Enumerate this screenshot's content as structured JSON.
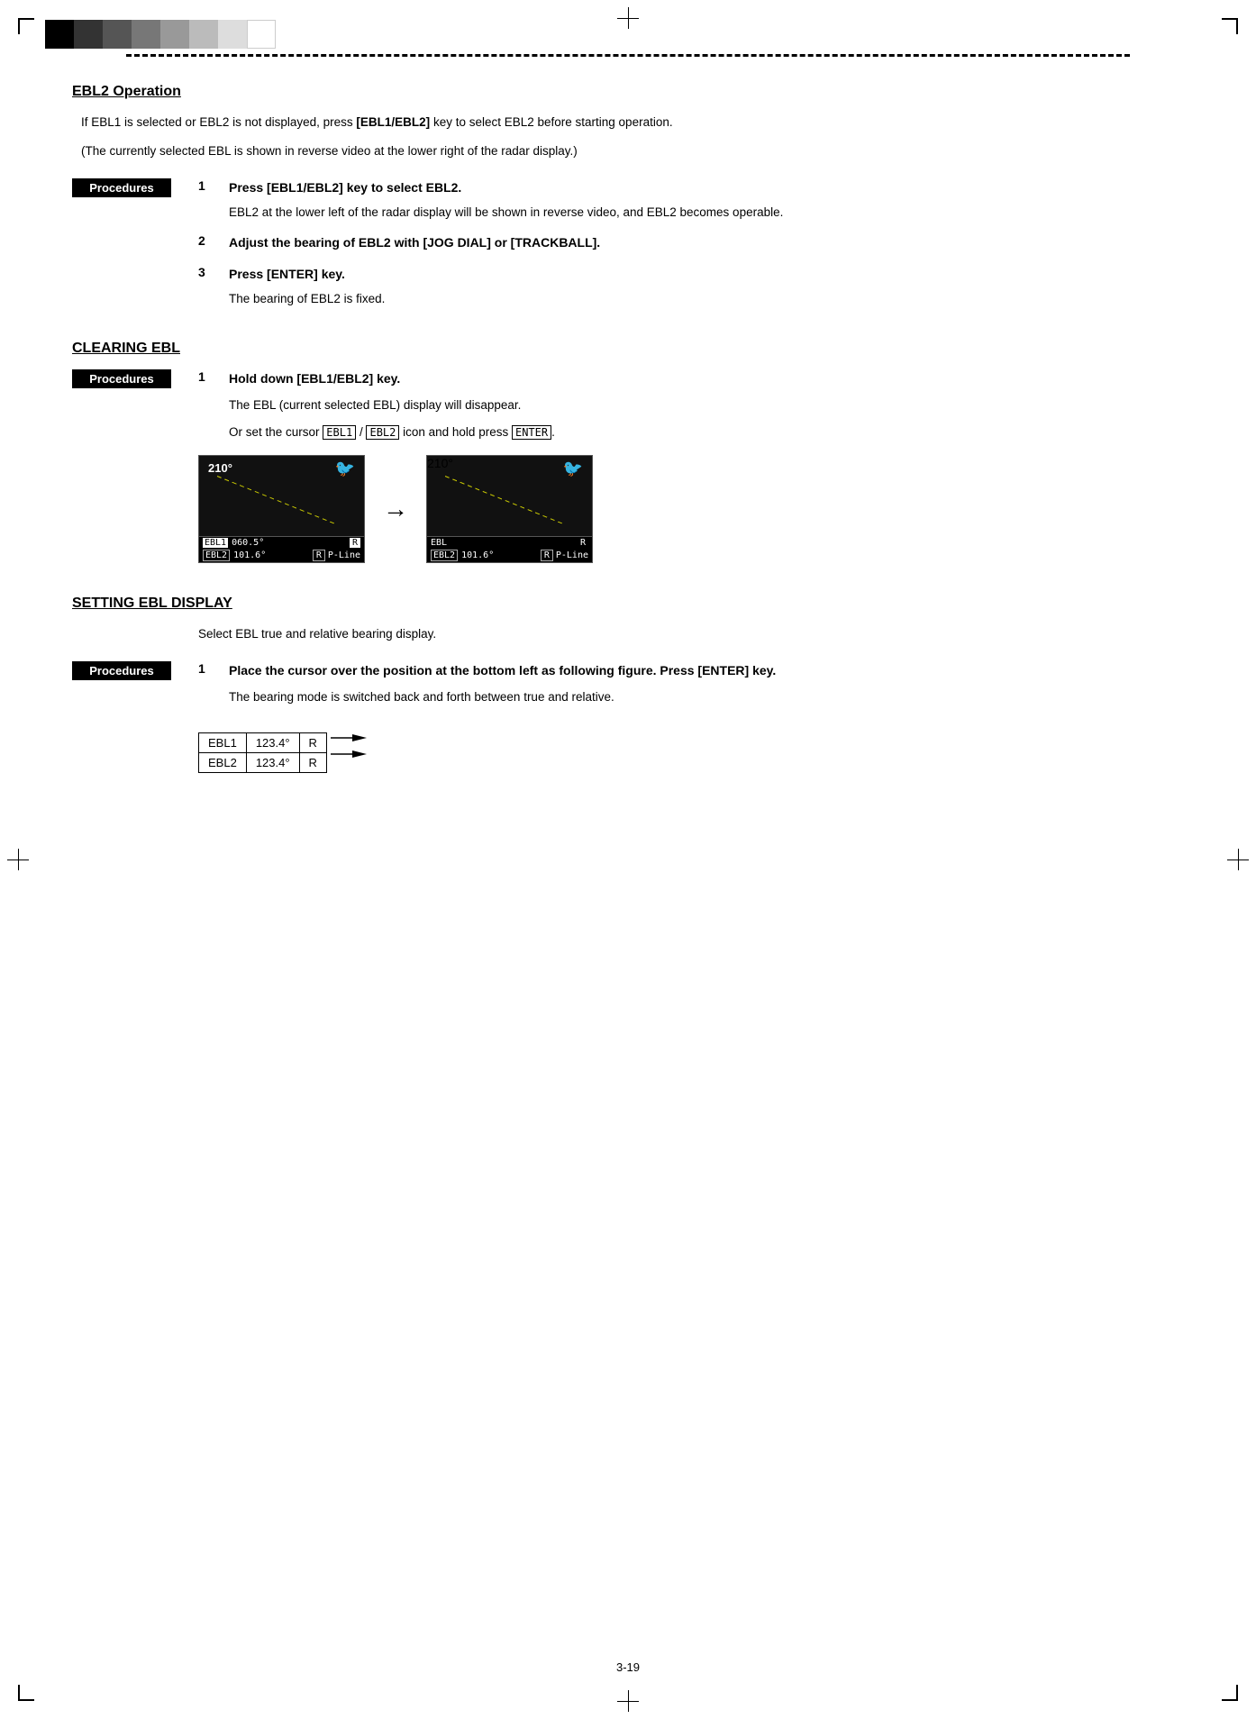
{
  "page": {
    "number": "3-19"
  },
  "colorBar": {
    "colors": [
      "#000000",
      "#333333",
      "#555555",
      "#777777",
      "#999999",
      "#bbbbbb",
      "#dddddd",
      "#ffffff"
    ]
  },
  "sections": {
    "ebl2Operation": {
      "title": "EBL2 Operation",
      "intro1": "If EBL1 is selected or EBL2 is not displayed, press [EBL1/EBL2] key to select EBL2 before starting operation.",
      "intro2": "(The currently selected EBL is shown in reverse video at the lower right of the radar display.)",
      "procedures_label": "Procedures",
      "steps": [
        {
          "num": "1",
          "title": "Press [EBL1/EBL2] key to select EBL2.",
          "desc": "EBL2 at the lower left of the radar display will be shown in reverse video, and EBL2 becomes operable."
        },
        {
          "num": "2",
          "title": "Adjust the bearing of EBL2 with [JOG DIAL] or [TRACKBALL].",
          "desc": ""
        },
        {
          "num": "3",
          "title": "Press [ENTER] key.",
          "desc": "The bearing of EBL2 is fixed."
        }
      ]
    },
    "clearingEBL": {
      "title": "CLEARING EBL",
      "procedures_label": "Procedures",
      "steps": [
        {
          "num": "1",
          "title": "Hold down [EBL1/EBL2] key.",
          "desc1": "The EBL (current selected EBL) display will disappear.",
          "desc2": "Or set the cursor"
        }
      ],
      "radarBefore": {
        "angle": "210°",
        "rows": [
          {
            "label": "EBL1",
            "value": "060.5°",
            "badge": "R",
            "type": "inverse"
          },
          {
            "label": "EBL2",
            "value": "101.6°",
            "badge": "R",
            "suffix": "P-Line",
            "type": "outline"
          }
        ]
      },
      "radarAfter": {
        "angle": "210°",
        "rows": [
          {
            "label": "EBL",
            "value": "",
            "badge": "",
            "type": "blank"
          },
          {
            "label": "EBL2",
            "value": "101.6°",
            "badge": "R",
            "suffix": "P-Line",
            "type": "outline"
          }
        ]
      }
    },
    "settingEBLDisplay": {
      "title": "SETTING EBL DISPLAY",
      "intro": "Select EBL true and relative bearing display.",
      "procedures_label": "Procedures",
      "steps": [
        {
          "num": "1",
          "title": "Place the cursor over the position at the bottom left as following figure. Press [ENTER] key.",
          "desc": "The bearing mode is switched back and forth between true and relative."
        }
      ],
      "table": {
        "rows": [
          {
            "col1": "EBL1",
            "col2": "123.4°",
            "col3": "R"
          },
          {
            "col1": "EBL2",
            "col2": "123.4°",
            "col3": "R"
          }
        ]
      }
    }
  }
}
